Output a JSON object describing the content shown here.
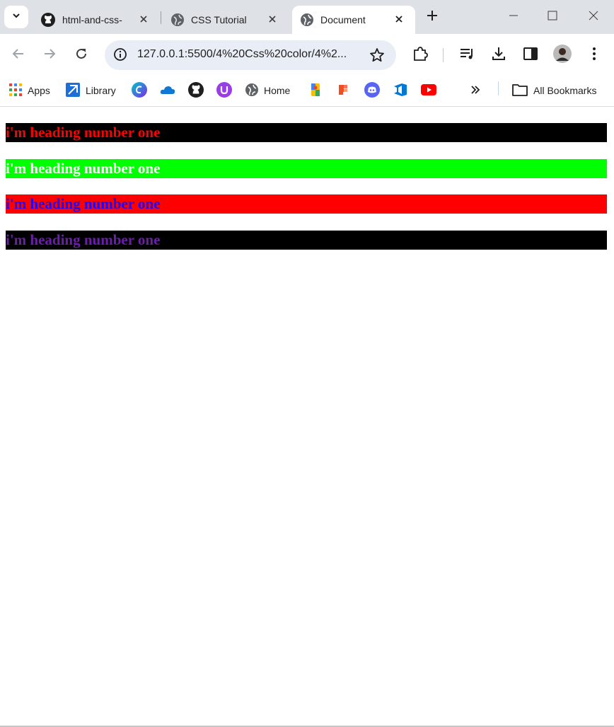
{
  "tabs": [
    {
      "title": "html-and-css-",
      "icon": "github-icon"
    },
    {
      "title": "CSS Tutorial",
      "icon": "globe-icon"
    },
    {
      "title": "Document",
      "icon": "globe-icon",
      "active": true
    }
  ],
  "address_bar": {
    "url": "127.0.0.1:5500/4%20Css%20color/4%2..."
  },
  "bookmarks": [
    {
      "label": "Apps",
      "icon": "apps-grid-icon"
    },
    {
      "label": "Library",
      "icon": "library-icon"
    },
    {
      "label": "",
      "icon": "canva-icon"
    },
    {
      "label": "",
      "icon": "onedrive-icon"
    },
    {
      "label": "",
      "icon": "github-icon"
    },
    {
      "label": "",
      "icon": "upwork-icon"
    },
    {
      "label": "Home",
      "icon": "globe-icon"
    },
    {
      "label": "",
      "icon": "google-maps-icon"
    },
    {
      "label": "",
      "icon": "figma-icon"
    },
    {
      "label": "",
      "icon": "discord-icon"
    },
    {
      "label": "",
      "icon": "azure-devops-icon"
    },
    {
      "label": "",
      "icon": "youtube-icon"
    }
  ],
  "all_bookmarks_label": "All Bookmarks",
  "headings": [
    {
      "text": "i'm heading number one",
      "color": "#ff0000",
      "background": "#000000"
    },
    {
      "text": "i'm heading number one",
      "color": "#ffffff",
      "background": "#00ff00"
    },
    {
      "text": "i'm heading number one",
      "color": "#1a00ff",
      "background": "#ff0000"
    },
    {
      "text": "i'm heading number one",
      "color": "#6a1fa8",
      "background": "#000000"
    }
  ]
}
